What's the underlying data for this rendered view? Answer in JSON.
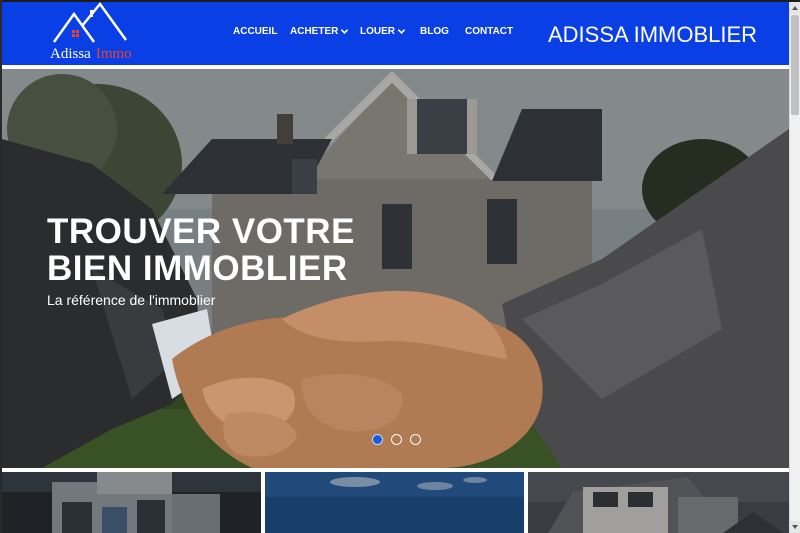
{
  "header": {
    "logo": {
      "word1": "Adissa",
      "word2": "Immo"
    },
    "nav": [
      {
        "label": "ACCUEIL",
        "has_dropdown": false
      },
      {
        "label": "ACHETER",
        "has_dropdown": true
      },
      {
        "label": "LOUER",
        "has_dropdown": true
      },
      {
        "label": "BLOG",
        "has_dropdown": false
      },
      {
        "label": "CONTACT",
        "has_dropdown": false
      }
    ],
    "brand_title": "ADISSA IMMOBLIER",
    "background_color": "#0a3fe6"
  },
  "hero": {
    "title_line1": "TROUVER VOTRE",
    "title_line2": "BIEN IMMOBLIER",
    "subtitle": "La référence de l'immoblier",
    "carousel": {
      "slides": 3,
      "active_index": 0
    }
  },
  "cards": [
    {
      "icon": "modern-building-image"
    },
    {
      "icon": "sky-image"
    },
    {
      "icon": "house-image"
    }
  ],
  "icons": {
    "chevron": "chevron-down-icon",
    "logo": "house-roof-logo-icon"
  }
}
